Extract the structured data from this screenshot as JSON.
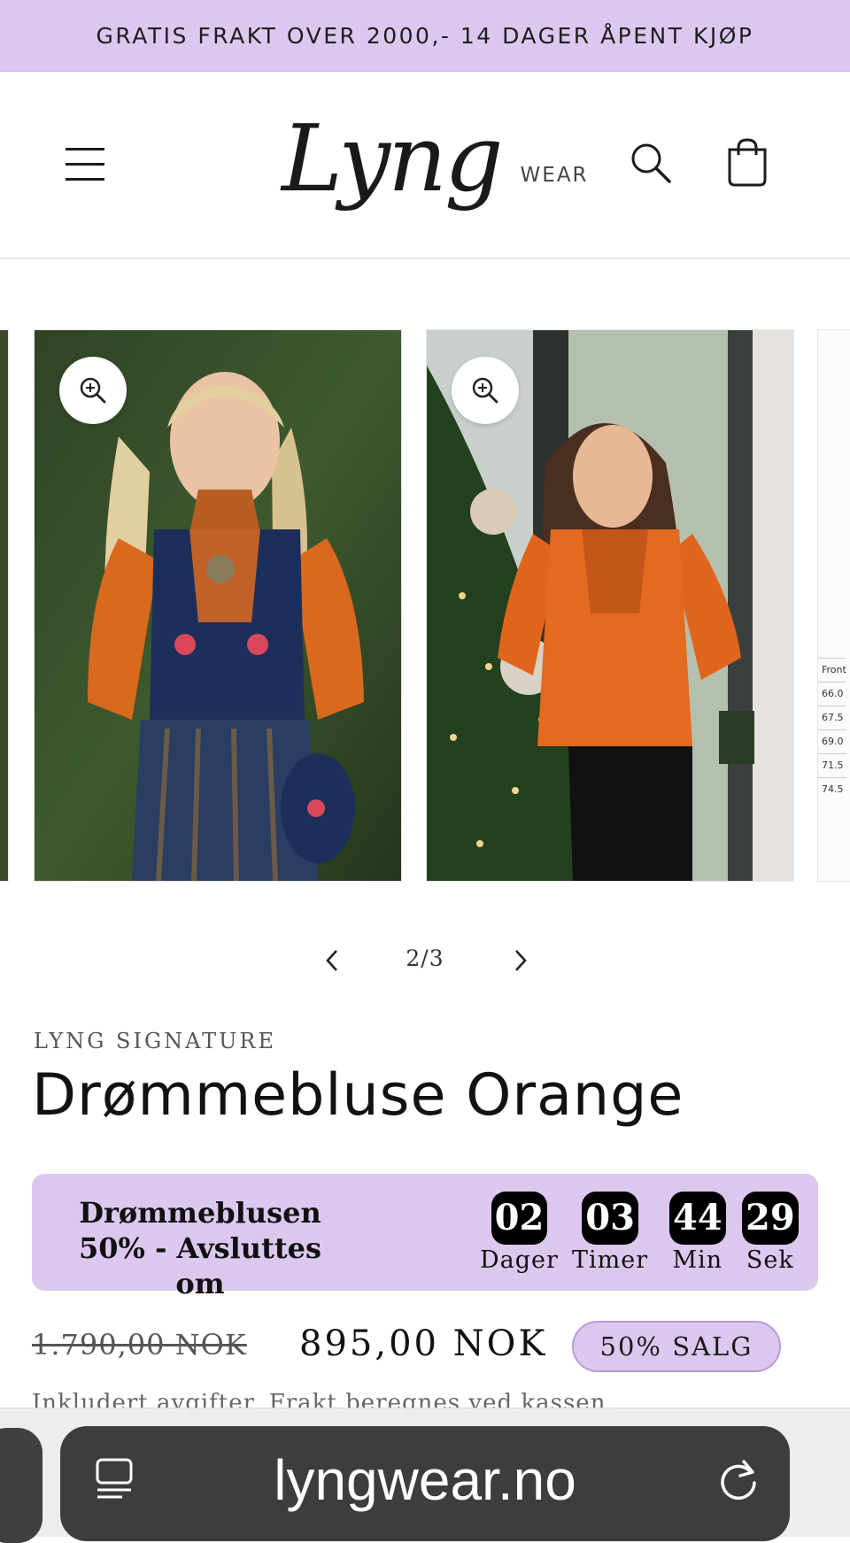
{
  "announcement": {
    "text": "GRATIS FRAKT OVER 2000,- 14 DAGER ÅPENT KJØP"
  },
  "header": {
    "logo_main": "Lyng",
    "logo_sub": "WEAR",
    "icons": {
      "menu": "hamburger-menu-icon",
      "search": "search-icon",
      "cart": "shopping-bag-icon"
    }
  },
  "gallery": {
    "zoom_icon": "zoom-in-icon",
    "size_chart_labels": [
      "Front",
      "66.0",
      "67.5",
      "69.0",
      "71.5",
      "74.5"
    ]
  },
  "pager": {
    "current": 2,
    "total": 3,
    "label": "2/3"
  },
  "product": {
    "vendor": "LYNG SIGNATURE",
    "title": "Drømmebluse Orange"
  },
  "countdown": {
    "label": "Drømmeblusen 50% - Avsluttes om",
    "units": [
      {
        "value": "02",
        "name": "Dager"
      },
      {
        "value": "03",
        "name": "Timer"
      },
      {
        "value": "44",
        "name": "Min"
      },
      {
        "value": "29",
        "name": "Sek"
      }
    ]
  },
  "price": {
    "original": "1.790,00 NOK",
    "sale": "895,00 NOK",
    "badge": "50% SALG",
    "tax_note": "Inkludert avgifter. Frakt beregnes ved kassen."
  },
  "browser": {
    "url": "lyngwear.no",
    "icons": {
      "reader": "reader-mode-icon",
      "reload": "reload-icon"
    }
  },
  "colors": {
    "accent_lavender": "#dcc8ef",
    "text_dark": "#121212",
    "countdown_box": "#000000"
  }
}
